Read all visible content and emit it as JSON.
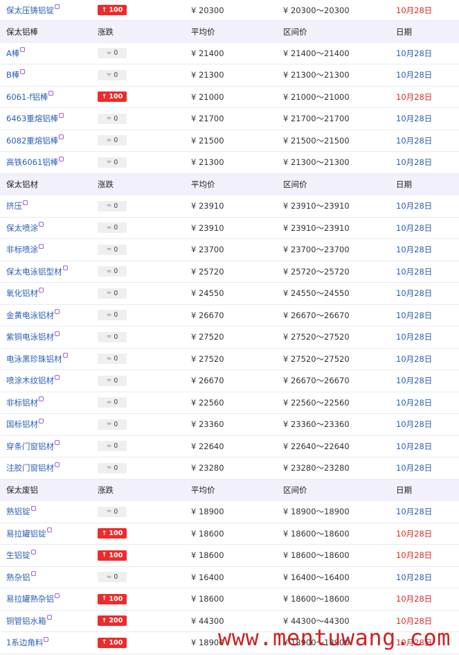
{
  "headers": {
    "name_col": "",
    "change": "涨跌",
    "avg": "平均价",
    "range": "区间价",
    "date": "日期"
  },
  "currency": "¥",
  "sections": [
    {
      "title": "",
      "rows": [
        {
          "name": "保太压铸铝锭",
          "change": "100",
          "dir": "up",
          "avg": "¥ 20300",
          "range": "¥ 20300～20300",
          "date": "10月28日",
          "date_color": "red"
        }
      ]
    },
    {
      "title": "保太铝棒",
      "rows": [
        {
          "name": "A棒",
          "change": "0",
          "dir": "flat",
          "avg": "¥ 21400",
          "range": "¥ 21400～21400",
          "date": "10月28日",
          "date_color": "blue"
        },
        {
          "name": "B棒",
          "change": "0",
          "dir": "flat",
          "avg": "¥ 21300",
          "range": "¥ 21300～21300",
          "date": "10月28日",
          "date_color": "blue"
        },
        {
          "name": "6061-f铝棒",
          "change": "100",
          "dir": "up",
          "avg": "¥ 21000",
          "range": "¥ 21000～21000",
          "date": "10月28日",
          "date_color": "red"
        },
        {
          "name": "6463重熔铝棒",
          "change": "0",
          "dir": "flat",
          "avg": "¥ 21700",
          "range": "¥ 21700～21700",
          "date": "10月28日",
          "date_color": "blue"
        },
        {
          "name": "6082重熔铝棒",
          "change": "0",
          "dir": "flat",
          "avg": "¥ 21500",
          "range": "¥ 21500～21500",
          "date": "10月28日",
          "date_color": "blue"
        },
        {
          "name": "高铁6061铝棒",
          "change": "0",
          "dir": "flat",
          "avg": "¥ 21300",
          "range": "¥ 21300～21300",
          "date": "10月28日",
          "date_color": "blue"
        }
      ]
    },
    {
      "title": "保太铝材",
      "rows": [
        {
          "name": "挤压",
          "change": "0",
          "dir": "flat",
          "avg": "¥ 23910",
          "range": "¥ 23910～23910",
          "date": "10月28日",
          "date_color": "blue"
        },
        {
          "name": "保太喷涂",
          "change": "0",
          "dir": "flat",
          "avg": "¥ 23910",
          "range": "¥ 23910～23910",
          "date": "10月28日",
          "date_color": "blue"
        },
        {
          "name": "非标喷涂",
          "change": "0",
          "dir": "flat",
          "avg": "¥ 23700",
          "range": "¥ 23700～23700",
          "date": "10月28日",
          "date_color": "blue"
        },
        {
          "name": "保太电泳铝型材",
          "change": "0",
          "dir": "flat",
          "avg": "¥ 25720",
          "range": "¥ 25720～25720",
          "date": "10月28日",
          "date_color": "blue"
        },
        {
          "name": "氧化铝材",
          "change": "0",
          "dir": "flat",
          "avg": "¥ 24550",
          "range": "¥ 24550～24550",
          "date": "10月28日",
          "date_color": "blue"
        },
        {
          "name": "金黄电泳铝材",
          "change": "0",
          "dir": "flat",
          "avg": "¥ 26670",
          "range": "¥ 26670～26670",
          "date": "10月28日",
          "date_color": "blue"
        },
        {
          "name": "紫铜电泳铝材",
          "change": "0",
          "dir": "flat",
          "avg": "¥ 27520",
          "range": "¥ 27520～27520",
          "date": "10月28日",
          "date_color": "blue"
        },
        {
          "name": "电泳黑珍珠铝材",
          "change": "0",
          "dir": "flat",
          "avg": "¥ 27520",
          "range": "¥ 27520～27520",
          "date": "10月28日",
          "date_color": "blue"
        },
        {
          "name": "喷涂木纹铝材",
          "change": "0",
          "dir": "flat",
          "avg": "¥ 26670",
          "range": "¥ 26670～26670",
          "date": "10月28日",
          "date_color": "blue"
        },
        {
          "name": "非标铝材",
          "change": "0",
          "dir": "flat",
          "avg": "¥ 22560",
          "range": "¥ 22560～22560",
          "date": "10月28日",
          "date_color": "blue"
        },
        {
          "name": "国标铝材",
          "change": "0",
          "dir": "flat",
          "avg": "¥ 23360",
          "range": "¥ 23360～23360",
          "date": "10月28日",
          "date_color": "blue"
        },
        {
          "name": "穿条门窗铝材",
          "change": "0",
          "dir": "flat",
          "avg": "¥ 22640",
          "range": "¥ 22640～22640",
          "date": "10月28日",
          "date_color": "blue"
        },
        {
          "name": "注胶门窗铝材",
          "change": "0",
          "dir": "flat",
          "avg": "¥ 23280",
          "range": "¥ 23280～23280",
          "date": "10月28日",
          "date_color": "blue"
        }
      ]
    },
    {
      "title": "保太废铝",
      "rows": [
        {
          "name": "熟铝锭",
          "change": "0",
          "dir": "flat",
          "avg": "¥ 18900",
          "range": "¥ 18900～18900",
          "date": "10月28日",
          "date_color": "blue"
        },
        {
          "name": "易拉罐铝锭",
          "change": "100",
          "dir": "up",
          "avg": "¥ 18600",
          "range": "¥ 18600～18600",
          "date": "10月28日",
          "date_color": "red"
        },
        {
          "name": "生铝锭",
          "change": "100",
          "dir": "up",
          "avg": "¥ 18600",
          "range": "¥ 18600～18600",
          "date": "10月28日",
          "date_color": "red"
        },
        {
          "name": "熟杂铝",
          "change": "0",
          "dir": "flat",
          "avg": "¥ 16400",
          "range": "¥ 16400～16400",
          "date": "10月28日",
          "date_color": "blue"
        },
        {
          "name": "易拉罐熟杂铝",
          "change": "100",
          "dir": "up",
          "avg": "¥ 18600",
          "range": "¥ 18600～18600",
          "date": "10月28日",
          "date_color": "red"
        },
        {
          "name": "铜管铝水箱",
          "change": "200",
          "dir": "up",
          "avg": "¥ 44300",
          "range": "¥ 44300～44300",
          "date": "10月28日",
          "date_color": "red"
        },
        {
          "name": "1系边角料",
          "change": "100",
          "dir": "up",
          "avg": "¥ 18900",
          "range": "¥ 18900～18900",
          "date": "10月28日",
          "date_color": "red"
        }
      ]
    }
  ],
  "watermark": "www.mentuwang.com"
}
